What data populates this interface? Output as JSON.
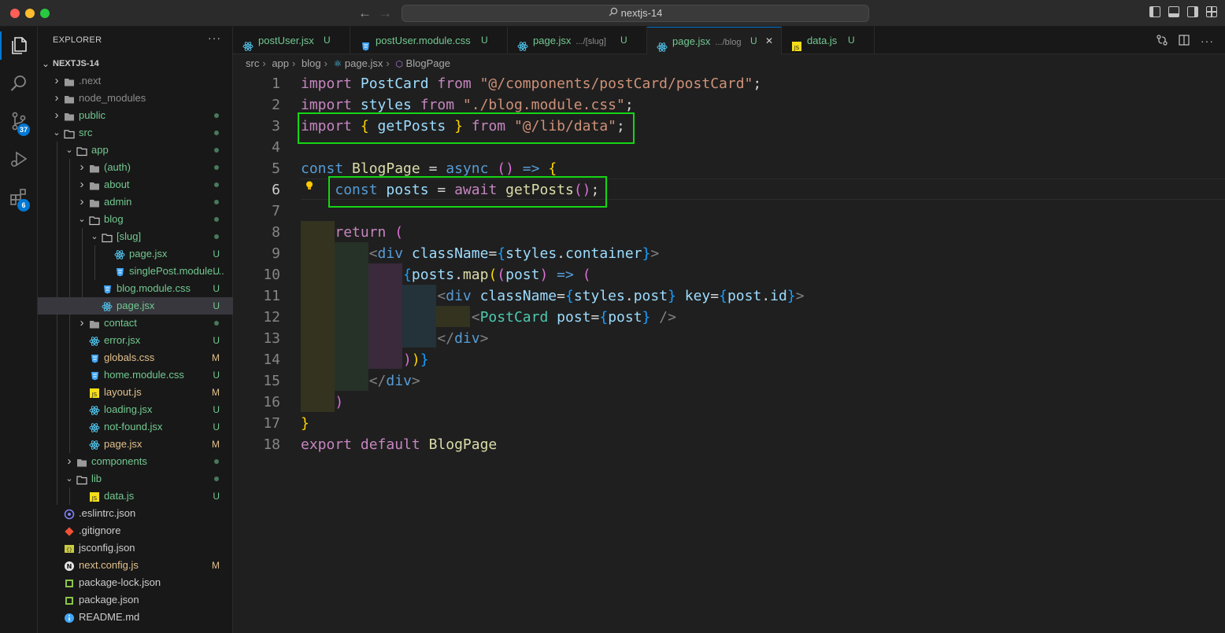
{
  "window": {
    "search_text": "nextjs-14",
    "back_glyph": "←",
    "forward_glyph": "→"
  },
  "activity_bar": {
    "items": [
      {
        "icon": "files-icon",
        "badge": ""
      },
      {
        "icon": "search-icon",
        "badge": ""
      },
      {
        "icon": "source-control-icon",
        "badge": "37"
      },
      {
        "icon": "run-debug-icon",
        "badge": ""
      },
      {
        "icon": "extensions-icon",
        "badge": "6"
      }
    ]
  },
  "sidebar": {
    "title": "EXPLORER",
    "more": "···",
    "root": "NEXTJS-14",
    "tree": [
      {
        "name": ".next",
        "depth": 0,
        "kind": "folder",
        "open": false,
        "deco": ""
      },
      {
        "name": "node_modules",
        "depth": 0,
        "kind": "folder",
        "open": false,
        "deco": ""
      },
      {
        "name": "public",
        "depth": 0,
        "kind": "folder",
        "open": false,
        "deco": "dot"
      },
      {
        "name": "src",
        "depth": 0,
        "kind": "folder",
        "open": true,
        "deco": "dot"
      },
      {
        "name": "app",
        "depth": 1,
        "kind": "folder",
        "open": true,
        "deco": "dot"
      },
      {
        "name": "(auth)",
        "depth": 2,
        "kind": "folder",
        "open": false,
        "deco": "dot"
      },
      {
        "name": "about",
        "depth": 2,
        "kind": "folder",
        "open": false,
        "deco": "dot"
      },
      {
        "name": "admin",
        "depth": 2,
        "kind": "folder",
        "open": false,
        "deco": "dot"
      },
      {
        "name": "blog",
        "depth": 2,
        "kind": "folder",
        "open": true,
        "deco": "dot"
      },
      {
        "name": "[slug]",
        "depth": 3,
        "kind": "folder",
        "open": true,
        "deco": "dot"
      },
      {
        "name": "page.jsx",
        "depth": 4,
        "kind": "react",
        "deco": "U"
      },
      {
        "name": "singlePost.module....",
        "depth": 4,
        "kind": "css",
        "deco": "U"
      },
      {
        "name": "blog.module.css",
        "depth": 3,
        "kind": "css",
        "deco": "U"
      },
      {
        "name": "page.jsx",
        "depth": 3,
        "kind": "react",
        "deco": "U",
        "selected": true
      },
      {
        "name": "contact",
        "depth": 2,
        "kind": "folder",
        "open": false,
        "deco": "dot"
      },
      {
        "name": "error.jsx",
        "depth": 2,
        "kind": "react",
        "deco": "U"
      },
      {
        "name": "globals.css",
        "depth": 2,
        "kind": "css",
        "deco": "M"
      },
      {
        "name": "home.module.css",
        "depth": 2,
        "kind": "css",
        "deco": "U"
      },
      {
        "name": "layout.js",
        "depth": 2,
        "kind": "js",
        "deco": "M"
      },
      {
        "name": "loading.jsx",
        "depth": 2,
        "kind": "react",
        "deco": "U"
      },
      {
        "name": "not-found.jsx",
        "depth": 2,
        "kind": "react",
        "deco": "U"
      },
      {
        "name": "page.jsx",
        "depth": 2,
        "kind": "react",
        "deco": "M"
      },
      {
        "name": "components",
        "depth": 1,
        "kind": "folder",
        "open": false,
        "deco": "dot"
      },
      {
        "name": "lib",
        "depth": 1,
        "kind": "folder",
        "open": true,
        "deco": "dot"
      },
      {
        "name": "data.js",
        "depth": 2,
        "kind": "js",
        "deco": "U"
      },
      {
        "name": ".eslintrc.json",
        "depth": 0,
        "kind": "eslint",
        "deco": ""
      },
      {
        "name": ".gitignore",
        "depth": 0,
        "kind": "git",
        "deco": ""
      },
      {
        "name": "jsconfig.json",
        "depth": 0,
        "kind": "jsconfig",
        "deco": ""
      },
      {
        "name": "next.config.js",
        "depth": 0,
        "kind": "next",
        "deco": "M"
      },
      {
        "name": "package-lock.json",
        "depth": 0,
        "kind": "npm",
        "deco": ""
      },
      {
        "name": "package.json",
        "depth": 0,
        "kind": "npm",
        "deco": ""
      },
      {
        "name": "README.md",
        "depth": 0,
        "kind": "info",
        "deco": ""
      }
    ]
  },
  "tabs": [
    {
      "name": "postUser.jsx",
      "desc": "",
      "kind": "react",
      "status": "U",
      "active": false
    },
    {
      "name": "postUser.module.css",
      "desc": "",
      "kind": "css",
      "status": "U",
      "active": false
    },
    {
      "name": "page.jsx",
      "desc": ".../[slug]",
      "kind": "react",
      "status": "U",
      "active": false
    },
    {
      "name": "page.jsx",
      "desc": ".../blog",
      "kind": "react",
      "status": "U",
      "active": true
    },
    {
      "name": "data.js",
      "desc": "",
      "kind": "js",
      "status": "U",
      "active": false
    }
  ],
  "breadcrumbs": [
    "src",
    "app",
    "blog",
    "page.jsx",
    "BlogPage"
  ],
  "editor": {
    "current_line": 6,
    "lines": [
      [
        [
          "kwc",
          "import "
        ],
        [
          "var",
          "PostCard"
        ],
        [
          "kwc",
          " from "
        ],
        [
          "str",
          "\"@/components/postCard/postCard\""
        ],
        [
          "plain",
          ";"
        ]
      ],
      [
        [
          "kwc",
          "import "
        ],
        [
          "var",
          "styles"
        ],
        [
          "kwc",
          " from "
        ],
        [
          "str",
          "\"./blog.module.css\""
        ],
        [
          "plain",
          ";"
        ]
      ],
      [
        [
          "kwc",
          "import "
        ],
        [
          "b1",
          "{ "
        ],
        [
          "var",
          "getPosts"
        ],
        [
          "b1",
          " }"
        ],
        [
          "kwc",
          " from "
        ],
        [
          "str",
          "\"@/lib/data\""
        ],
        [
          "plain",
          ";"
        ]
      ],
      [],
      [
        [
          "kw",
          "const "
        ],
        [
          "fn",
          "BlogPage"
        ],
        [
          "plain",
          " = "
        ],
        [
          "kw",
          "async "
        ],
        [
          "b2",
          "()"
        ],
        [
          "kw",
          " => "
        ],
        [
          "b1",
          "{"
        ]
      ],
      [
        [
          "plain",
          "    "
        ],
        [
          "kw",
          "const "
        ],
        [
          "var",
          "posts"
        ],
        [
          "plain",
          " = "
        ],
        [
          "kwc",
          "await "
        ],
        [
          "fn",
          "getPosts"
        ],
        [
          "b2",
          "()"
        ],
        [
          "plain",
          ";"
        ]
      ],
      [],
      [
        [
          "plain",
          "    "
        ],
        [
          "kwc",
          "return "
        ],
        [
          "b2",
          "("
        ]
      ],
      [
        [
          "plain",
          "        "
        ],
        [
          "tag",
          "<"
        ],
        [
          "kw",
          "div "
        ],
        [
          "var",
          "className"
        ],
        [
          "plain",
          "="
        ],
        [
          "b3",
          "{"
        ],
        [
          "var",
          "styles"
        ],
        [
          "plain",
          "."
        ],
        [
          "var",
          "container"
        ],
        [
          "b3",
          "}"
        ],
        [
          "tag",
          ">"
        ]
      ],
      [
        [
          "plain",
          "            "
        ],
        [
          "b3",
          "{"
        ],
        [
          "var",
          "posts"
        ],
        [
          "plain",
          "."
        ],
        [
          "fn",
          "map"
        ],
        [
          "b1",
          "("
        ],
        [
          "b2",
          "("
        ],
        [
          "var",
          "post"
        ],
        [
          "b2",
          ")"
        ],
        [
          "kw",
          " => "
        ],
        [
          "b2",
          "("
        ]
      ],
      [
        [
          "plain",
          "                "
        ],
        [
          "tag",
          "<"
        ],
        [
          "kw",
          "div "
        ],
        [
          "var",
          "className"
        ],
        [
          "plain",
          "="
        ],
        [
          "b3",
          "{"
        ],
        [
          "var",
          "styles"
        ],
        [
          "plain",
          "."
        ],
        [
          "var",
          "post"
        ],
        [
          "b3",
          "}"
        ],
        [
          "var",
          " key"
        ],
        [
          "plain",
          "="
        ],
        [
          "b3",
          "{"
        ],
        [
          "var",
          "post"
        ],
        [
          "plain",
          "."
        ],
        [
          "var",
          "id"
        ],
        [
          "b3",
          "}"
        ],
        [
          "tag",
          ">"
        ]
      ],
      [
        [
          "plain",
          "                    "
        ],
        [
          "tag",
          "<"
        ],
        [
          "cls",
          "PostCard "
        ],
        [
          "var",
          "post"
        ],
        [
          "plain",
          "="
        ],
        [
          "b3",
          "{"
        ],
        [
          "var",
          "post"
        ],
        [
          "b3",
          "}"
        ],
        [
          "tag",
          " />"
        ]
      ],
      [
        [
          "plain",
          "                "
        ],
        [
          "tag",
          "</"
        ],
        [
          "kw",
          "div"
        ],
        [
          "tag",
          ">"
        ]
      ],
      [
        [
          "plain",
          "            "
        ],
        [
          "b2",
          ")"
        ],
        [
          "b1",
          ")"
        ],
        [
          "b3",
          "}"
        ]
      ],
      [
        [
          "plain",
          "        "
        ],
        [
          "tag",
          "</"
        ],
        [
          "kw",
          "div"
        ],
        [
          "tag",
          ">"
        ]
      ],
      [
        [
          "plain",
          "    "
        ],
        [
          "b2",
          ")"
        ]
      ],
      [
        [
          "b1",
          "}"
        ]
      ],
      [
        [
          "kwc",
          "export "
        ],
        [
          "kwc",
          "default "
        ],
        [
          "fn",
          "BlogPage"
        ]
      ]
    ]
  }
}
